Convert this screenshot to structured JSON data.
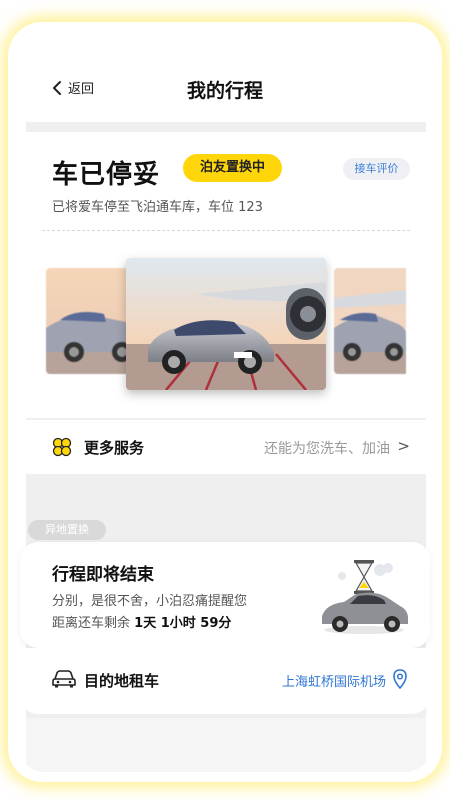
{
  "header": {
    "back_label": "返回",
    "title": "我的行程"
  },
  "status_card": {
    "status": "车已停妥",
    "badge": "泊友置换中",
    "review_button": "接车评价",
    "subtitle": "已将爱车停至飞泊通车库，车位 123"
  },
  "services": {
    "icon": "grid-flower-icon",
    "label": "更多服务",
    "hint": "还能为您洗车、加油",
    "arrow": ">"
  },
  "remote_tag": "异地置换",
  "trip": {
    "title": "行程即将结束",
    "line1": "分别，是很不舍，小泊忍痛提醒您",
    "countdown_prefix": "距离还车剩余",
    "countdown_value": "1天 1小时 59分"
  },
  "destination": {
    "icon": "car-icon",
    "label": "目的地租车",
    "value": "上海虹桥国际机场",
    "pin_icon": "location-pin-icon"
  },
  "colors": {
    "accent_yellow": "#ffd60a",
    "link_blue": "#2f76d2",
    "background_gray": "#efefef"
  }
}
